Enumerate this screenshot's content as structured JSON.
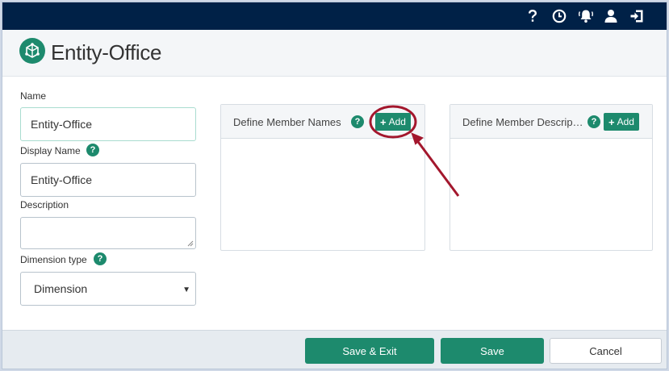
{
  "topbar": {
    "icons": [
      "help-icon",
      "history-icon",
      "notifications-icon",
      "user-icon",
      "logout-icon"
    ]
  },
  "header": {
    "title": "Entity-Office",
    "logo_icon": "entity-cube-icon"
  },
  "form": {
    "name_label": "Name",
    "name_value": "Entity-Office",
    "display_name_label": "Display Name",
    "display_name_value": "Entity-Office",
    "description_label": "Description",
    "description_value": "",
    "dimension_type_label": "Dimension type",
    "dimension_type_value": "Dimension",
    "help_glyph": "?"
  },
  "panels": {
    "member_names": {
      "title": "Define Member Names",
      "add_label": "Add"
    },
    "member_descriptions": {
      "title": "Define Member Descrip…",
      "add_label": "Add"
    }
  },
  "footer": {
    "save_exit_label": "Save & Exit",
    "save_label": "Save",
    "cancel_label": "Cancel"
  },
  "colors": {
    "topbar": "#002147",
    "accent": "#1d8a6d",
    "annotation": "#a3172d"
  }
}
